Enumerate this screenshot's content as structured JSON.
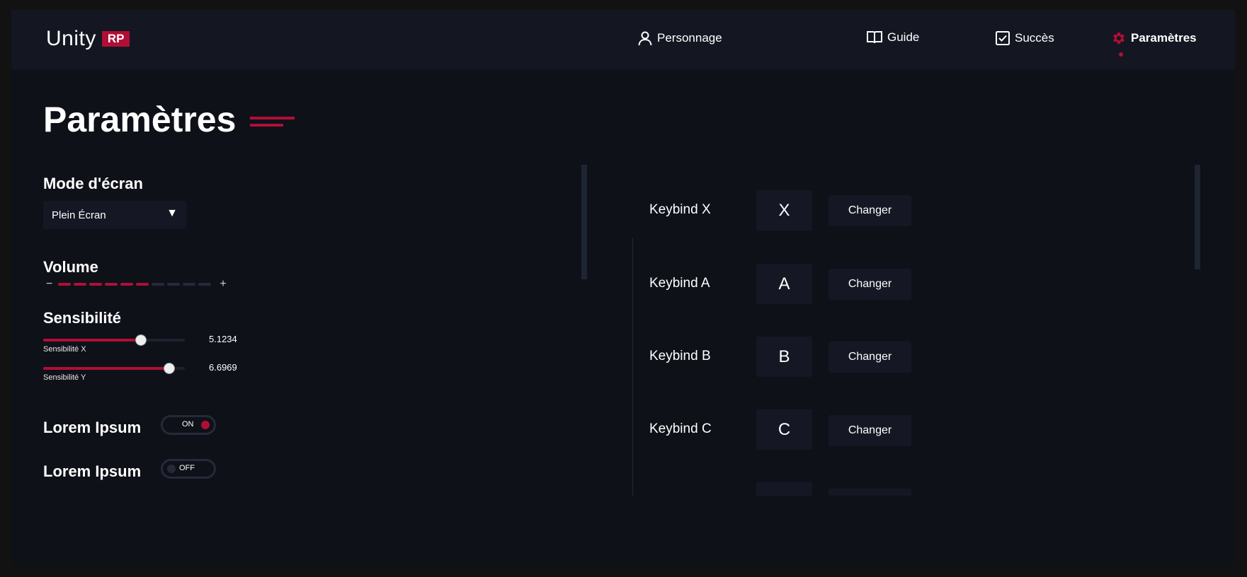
{
  "app": {
    "logo_text": "Unity",
    "logo_badge": "RP"
  },
  "nav": {
    "items": [
      {
        "label": "Personnage",
        "icon": "user-icon"
      },
      {
        "label": "Guide",
        "icon": "book-icon"
      },
      {
        "label": "Succès",
        "icon": "checkbox-icon"
      },
      {
        "label": "Paramètres",
        "icon": "gear-icon",
        "active": true
      }
    ]
  },
  "page": {
    "title": "Paramètres"
  },
  "screen_mode": {
    "label": "Mode d'écran",
    "selected": "Plein Écran"
  },
  "volume": {
    "label": "Volume",
    "minus": "−",
    "plus": "+",
    "level": 6,
    "max": 10
  },
  "sensitivity": {
    "label": "Sensibilité",
    "x": {
      "label": "Sensibilité X",
      "value": "5.1234",
      "fraction": 0.69
    },
    "y": {
      "label": "Sensibilité Y",
      "value": "6.6969",
      "fraction": 0.89
    }
  },
  "toggles": [
    {
      "label": "Lorem Ipsum",
      "state": "ON"
    },
    {
      "label": "Lorem Ipsum",
      "state": "OFF"
    }
  ],
  "keybinds": [
    {
      "label": "Keybind X",
      "key": "X",
      "button": "Changer"
    },
    {
      "label": "Keybind A",
      "key": "A",
      "button": "Changer"
    },
    {
      "label": "Keybind B",
      "key": "B",
      "button": "Changer"
    },
    {
      "label": "Keybind C",
      "key": "C",
      "button": "Changer"
    }
  ],
  "colors": {
    "accent": "#b10e36",
    "panel": "#0f1119",
    "header": "#141722"
  }
}
